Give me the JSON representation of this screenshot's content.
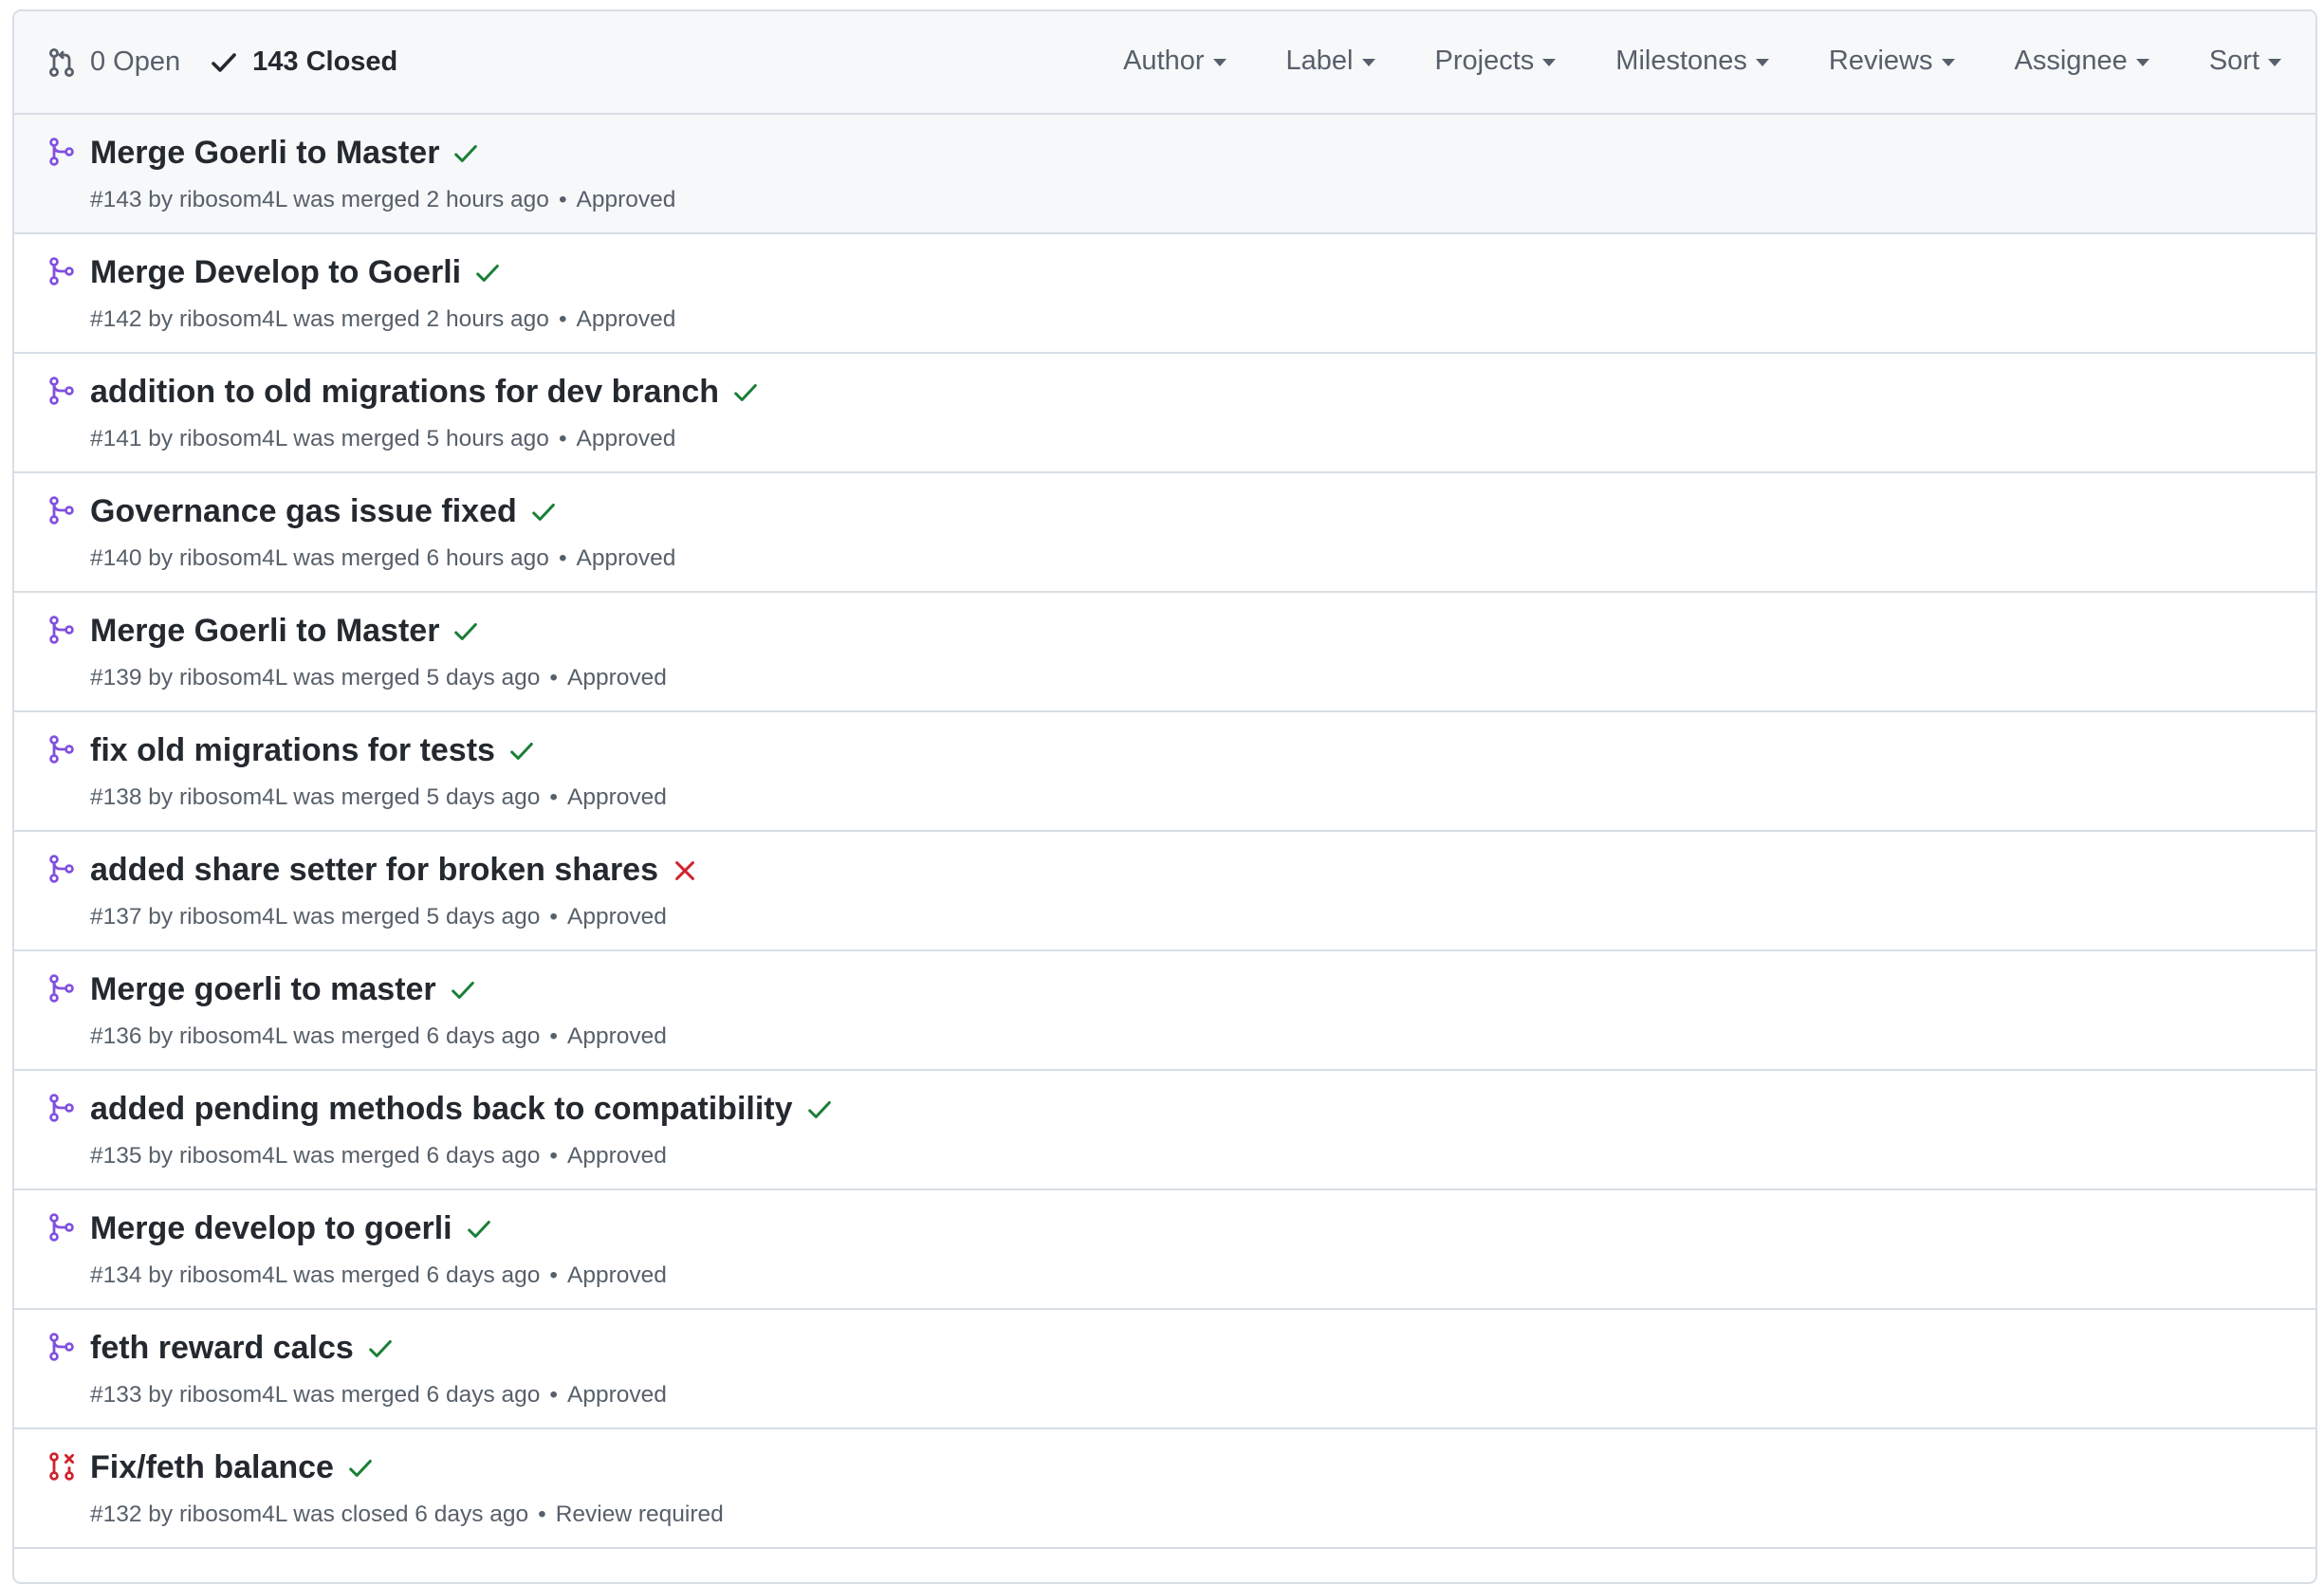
{
  "header": {
    "open_label": "0 Open",
    "closed_label": "143 Closed",
    "filters": [
      {
        "label": "Author"
      },
      {
        "label": "Label"
      },
      {
        "label": "Projects"
      },
      {
        "label": "Milestones"
      },
      {
        "label": "Reviews"
      },
      {
        "label": "Assignee"
      },
      {
        "label": "Sort"
      }
    ]
  },
  "colors": {
    "merged": "#8250df",
    "closed": "#cf222e",
    "success": "#1a7f37",
    "failure": "#cf222e"
  },
  "pull_requests": [
    {
      "title": "Merge Goerli to Master",
      "meta": "#143 by ribosom4L was merged 2 hours ago",
      "review": "Approved",
      "state": "merged",
      "check": "success",
      "state_icon": "git-merge-icon",
      "check_icon": "check-icon"
    },
    {
      "title": "Merge Develop to Goerli",
      "meta": "#142 by ribosom4L was merged 2 hours ago",
      "review": "Approved",
      "state": "merged",
      "check": "success",
      "state_icon": "git-merge-icon",
      "check_icon": "check-icon"
    },
    {
      "title": "addition to old migrations for dev branch",
      "meta": "#141 by ribosom4L was merged 5 hours ago",
      "review": "Approved",
      "state": "merged",
      "check": "success",
      "state_icon": "git-merge-icon",
      "check_icon": "check-icon"
    },
    {
      "title": "Governance gas issue fixed",
      "meta": "#140 by ribosom4L was merged 6 hours ago",
      "review": "Approved",
      "state": "merged",
      "check": "success",
      "state_icon": "git-merge-icon",
      "check_icon": "check-icon"
    },
    {
      "title": "Merge Goerli to Master",
      "meta": "#139 by ribosom4L was merged 5 days ago",
      "review": "Approved",
      "state": "merged",
      "check": "success",
      "state_icon": "git-merge-icon",
      "check_icon": "check-icon"
    },
    {
      "title": "fix old migrations for tests",
      "meta": "#138 by ribosom4L was merged 5 days ago",
      "review": "Approved",
      "state": "merged",
      "check": "success",
      "state_icon": "git-merge-icon",
      "check_icon": "check-icon"
    },
    {
      "title": "added share setter for broken shares",
      "meta": "#137 by ribosom4L was merged 5 days ago",
      "review": "Approved",
      "state": "merged",
      "check": "failure",
      "state_icon": "git-merge-icon",
      "check_icon": "x-icon"
    },
    {
      "title": "Merge goerli to master",
      "meta": "#136 by ribosom4L was merged 6 days ago",
      "review": "Approved",
      "state": "merged",
      "check": "success",
      "state_icon": "git-merge-icon",
      "check_icon": "check-icon"
    },
    {
      "title": "added pending methods back to compatibility",
      "meta": "#135 by ribosom4L was merged 6 days ago",
      "review": "Approved",
      "state": "merged",
      "check": "success",
      "state_icon": "git-merge-icon",
      "check_icon": "check-icon"
    },
    {
      "title": "Merge develop to goerli",
      "meta": "#134 by ribosom4L was merged 6 days ago",
      "review": "Approved",
      "state": "merged",
      "check": "success",
      "state_icon": "git-merge-icon",
      "check_icon": "check-icon"
    },
    {
      "title": "feth reward calcs",
      "meta": "#133 by ribosom4L was merged 6 days ago",
      "review": "Approved",
      "state": "merged",
      "check": "success",
      "state_icon": "git-merge-icon",
      "check_icon": "check-icon"
    },
    {
      "title": "Fix/feth balance",
      "meta": "#132 by ribosom4L was closed 6 days ago",
      "review": "Review required",
      "state": "closed",
      "check": "success",
      "state_icon": "git-pull-request-closed-icon",
      "check_icon": "check-icon"
    }
  ]
}
